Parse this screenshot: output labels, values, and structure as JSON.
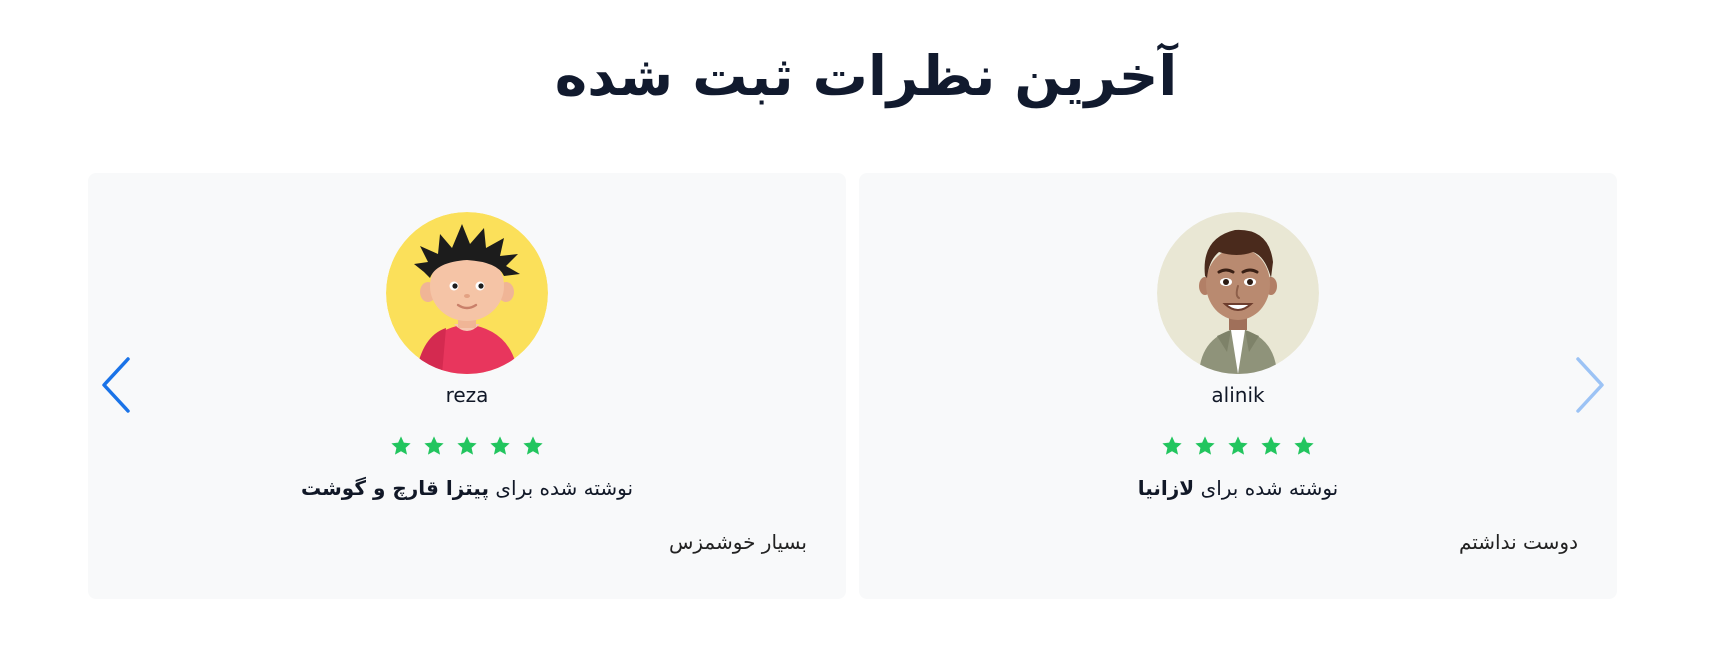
{
  "section": {
    "title": "آخرین نظرات ثبت شده"
  },
  "colors": {
    "star": "#22c55e",
    "arrow_active": "#1a73e8",
    "arrow_inactive": "#9cc3f5",
    "card_bg": "#f8f9fa"
  },
  "reviews": [
    {
      "username": "reza",
      "rating": 5,
      "written_prefix": "نوشته شده برای",
      "product": "پیتزا قارچ و گوشت",
      "comment": "بسیار خوشمزس",
      "avatar_icon": "cartoon-boy-avatar"
    },
    {
      "username": "alinik",
      "rating": 5,
      "written_prefix": "نوشته شده برای",
      "product": "لازانیا",
      "comment": "دوست نداشتم",
      "avatar_icon": "cartoon-man-avatar"
    }
  ],
  "nav": {
    "prev_icon": "chevron-left-icon",
    "next_icon": "chevron-right-icon"
  }
}
